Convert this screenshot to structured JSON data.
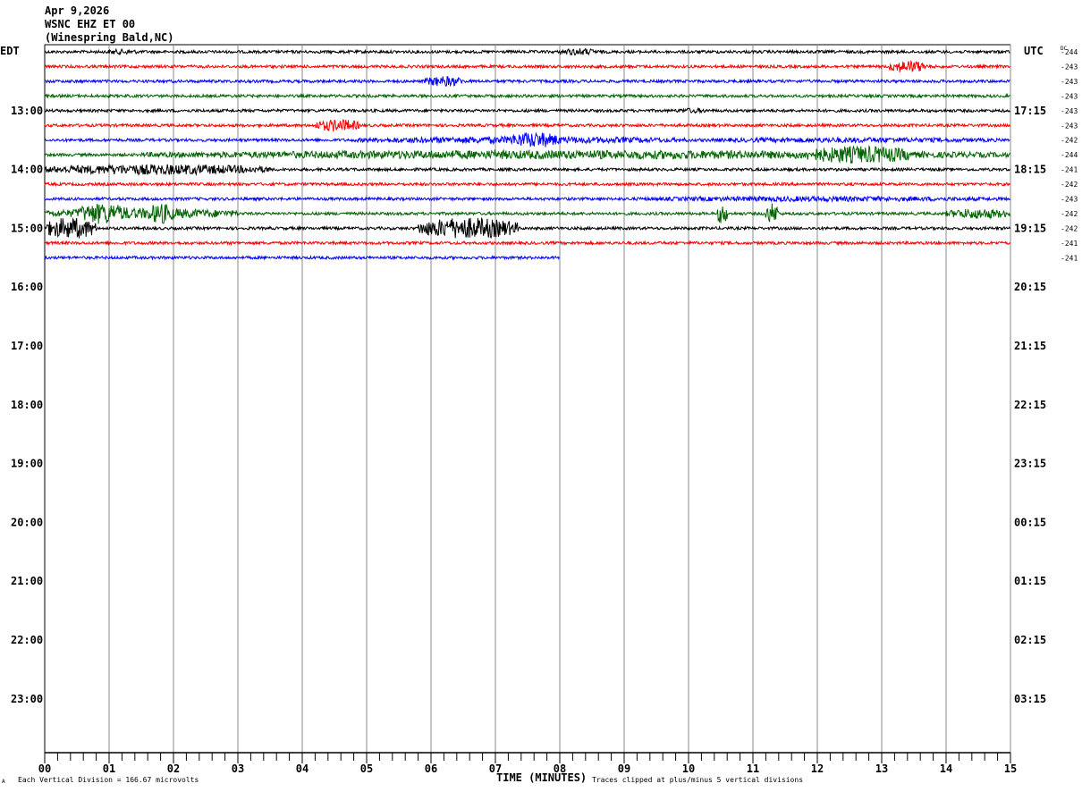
{
  "header": {
    "date": "Apr 9,2026",
    "station": "WSNC EHZ ET 00",
    "location": "(Winespring Bald,NC)"
  },
  "left_tz": "EDT",
  "right_tz": "UTC",
  "dc_label": "DC",
  "footer": {
    "scale": "Each Vertical Division =  166.67 microvolts",
    "xlabel": "TIME (MINUTES)",
    "clip_note": "Traces clipped at plus/minus 5 vertical divisions",
    "corner_mark": "A"
  },
  "chart_data": {
    "type": "line",
    "title": "WSNC EHZ ET 00 helicorder",
    "xlabel": "TIME (MINUTES)",
    "xlim": [
      0,
      15
    ],
    "x_ticks": [
      "00",
      "01",
      "02",
      "03",
      "04",
      "05",
      "06",
      "07",
      "08",
      "09",
      "10",
      "11",
      "12",
      "13",
      "14",
      "15"
    ],
    "rows_total": 48,
    "rows_per_hour": 4,
    "edt_labels": [
      "13:00",
      "14:00",
      "15:00",
      "16:00",
      "17:00",
      "18:00",
      "19:00",
      "20:00",
      "21:00",
      "22:00",
      "23:00"
    ],
    "utc_labels": [
      "17:15",
      "18:15",
      "19:15",
      "20:15",
      "21:15",
      "22:15",
      "23:15",
      "00:15",
      "01:15",
      "02:15",
      "03:15"
    ],
    "trace_colors": [
      "#000000",
      "#ff0000",
      "#0000ff",
      "#006400"
    ],
    "dc_offsets": [
      "-244",
      "-243",
      "-243",
      "-243",
      "-243",
      "-243",
      "-242",
      "-244",
      "-241",
      "-242",
      "-243",
      "-242",
      "-242",
      "-241",
      "-241"
    ],
    "last_row_end_minute": 8.0,
    "events": [
      {
        "row": 0,
        "start": 0.9,
        "end": 1.5,
        "amp": 3
      },
      {
        "row": 0,
        "start": 8.0,
        "end": 8.6,
        "amp": 4
      },
      {
        "row": 1,
        "start": 13.1,
        "end": 13.7,
        "amp": 7
      },
      {
        "row": 2,
        "start": 5.9,
        "end": 6.5,
        "amp": 6
      },
      {
        "row": 4,
        "start": 9.8,
        "end": 10.3,
        "amp": 3
      },
      {
        "row": 5,
        "start": 4.2,
        "end": 4.9,
        "amp": 7
      },
      {
        "row": 6,
        "start": 4.8,
        "end": 10,
        "amp": 4
      },
      {
        "row": 6,
        "start": 7.2,
        "end": 8.0,
        "amp": 9
      },
      {
        "row": 6,
        "start": 10,
        "end": 15,
        "amp": 3
      },
      {
        "row": 7,
        "start": 1.5,
        "end": 15,
        "amp": 5
      },
      {
        "row": 7,
        "start": 11.8,
        "end": 13.5,
        "amp": 10
      },
      {
        "row": 8,
        "start": 0,
        "end": 3.5,
        "amp": 6
      },
      {
        "row": 10,
        "start": 9,
        "end": 15,
        "amp": 3
      },
      {
        "row": 11,
        "start": 0,
        "end": 3,
        "amp": 6
      },
      {
        "row": 11,
        "start": 0.5,
        "end": 1.3,
        "amp": 12
      },
      {
        "row": 11,
        "start": 1.6,
        "end": 2.0,
        "amp": 12
      },
      {
        "row": 11,
        "start": 10.45,
        "end": 10.6,
        "amp": 12
      },
      {
        "row": 11,
        "start": 11.2,
        "end": 11.4,
        "amp": 12
      },
      {
        "row": 11,
        "start": 14,
        "end": 15,
        "amp": 6
      },
      {
        "row": 12,
        "start": 0,
        "end": 0.8,
        "amp": 12
      },
      {
        "row": 12,
        "start": 5.8,
        "end": 7.35,
        "amp": 12
      }
    ]
  }
}
